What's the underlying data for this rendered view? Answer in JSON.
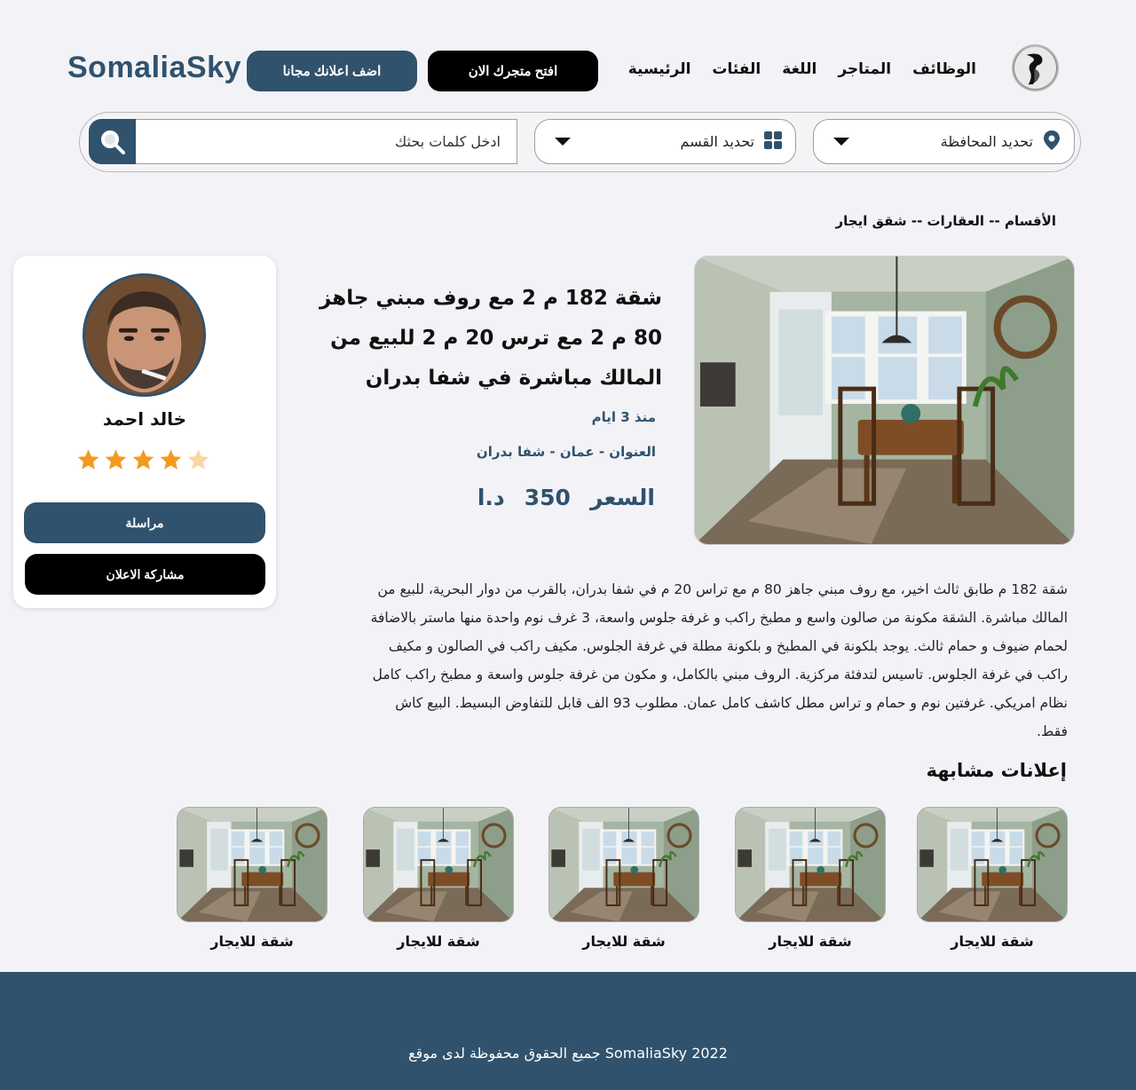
{
  "header": {
    "brand": "SomaliaSky",
    "nav": [
      "الرئيسية",
      "الفئات",
      "اللغة",
      "المتاجر",
      "الوظائف"
    ],
    "open_store_label": "افتح متجرك الان",
    "post_ad_label": "اضف اعلانك مجانا"
  },
  "search": {
    "governorate_label": "تحديد المحافظة",
    "category_label": "تحديد القسم",
    "keywords_placeholder": "ادخل كلمات بحثك",
    "keywords_value": ""
  },
  "breadcrumb": "الأقسام -- العقارات -- شقق ايجار",
  "seller": {
    "name": "خالد احمد",
    "rating": 4,
    "rating_max": 5,
    "message_label": "مراسلة",
    "share_label": "مشاركة الاعلان"
  },
  "listing": {
    "title": "شقة 182 م 2 مع روف مبني جاهز 80 م 2 مع ترس 20 م 2 للبيع من المالك مباشرة في شفا بدران",
    "posted": "منذ 3 ايام",
    "address": "العنوان - عمان - شفا بدران",
    "price_label": "السعر",
    "price_value": "350",
    "price_currency": "د.ا",
    "description": "شقة 182 م طابق ثالث اخير، مع روف مبني جاهز 80 م مع تراس 20 م في شفا بدران، بالقرب من دوار البحرية، للبيع من المالك مباشرة. الشقة مكونة من صالون واسع و مطبخ راكب و غرفة جلوس واسعة، 3 غرف نوم واحدة منها ماستر بالاضافة لحمام ضيوف و حمام ثالث. يوجد بلكونة في المطبخ و بلكونة مطلة في غرفة الجلوس. مكيف راكب في الصالون و مكيف راكب في غرفة الجلوس. تاسيس لتدفئة مركزية. الروف مبني بالكامل، و مكون من غرفة جلوس واسعة و مطبخ راكب كامل نظام امريكي. غرفتين نوم و حمام و تراس مطل كاشف كامل عمان. مطلوب 93 الف قابل للتفاوض البسيط. البيع كاش فقط."
  },
  "similar": {
    "title": "إعلانات مشابهة",
    "items": [
      {
        "caption": "شقة للايجار"
      },
      {
        "caption": "شقة للايجار"
      },
      {
        "caption": "شقة للايجار"
      },
      {
        "caption": "شقة للايجار"
      },
      {
        "caption": "شقة للايجار"
      }
    ]
  },
  "footer": {
    "copyright": "SomaliaSky 2022 جميع الحقوق محفوظة لدى موقع"
  },
  "colors": {
    "brand": "#30526d",
    "background": "#f3f3f7",
    "star": "#f39a1e",
    "star_empty": "#fbd6a4"
  },
  "icons": {
    "location": "map-pin-icon",
    "category": "grid-icon",
    "search": "search-icon",
    "caret": "chevron-down-icon",
    "star": "star-icon"
  }
}
